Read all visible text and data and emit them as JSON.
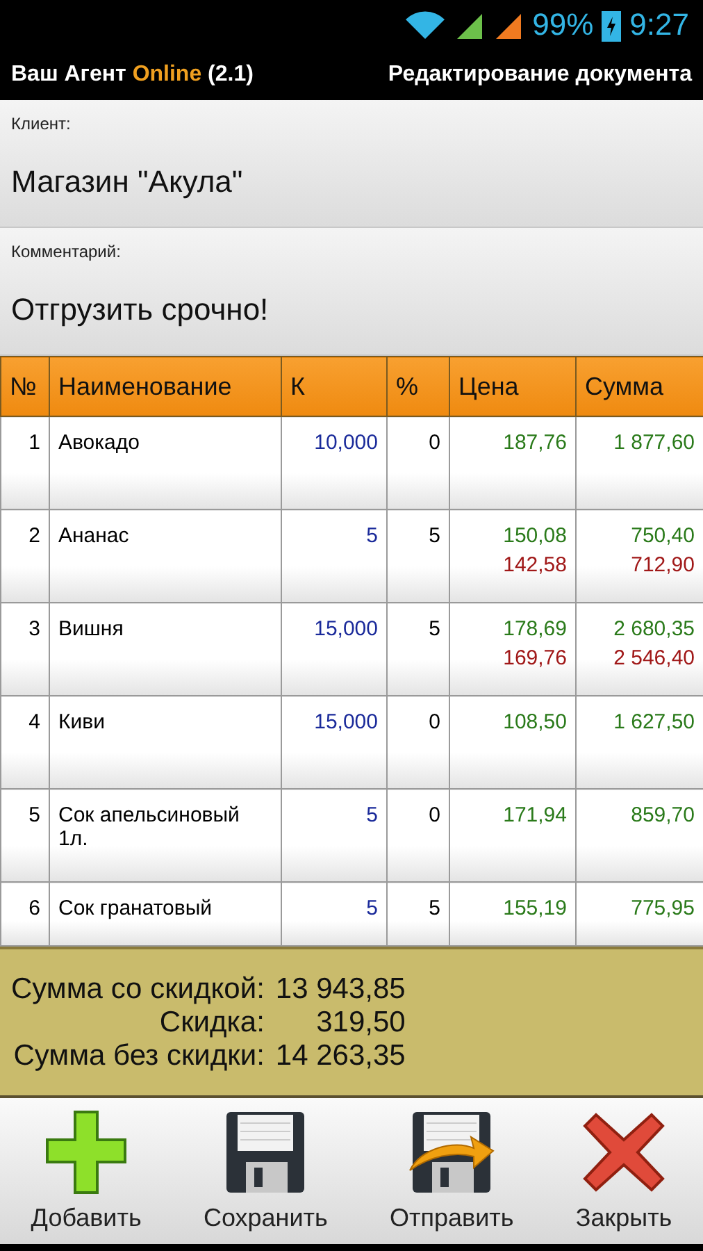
{
  "status_bar": {
    "battery": "99%",
    "time": "9:27"
  },
  "app_bar": {
    "title_prefix": "Ваш Агент",
    "title_accent": "Online",
    "version": "(2.1)",
    "screen_title": "Редактирование документа"
  },
  "fields": [
    {
      "label": "Клиент:",
      "value": "Магазин \"Акула\""
    },
    {
      "label": "Комментарий:",
      "value": "Отгрузить срочно!"
    }
  ],
  "table": {
    "columns": [
      "№",
      "Наименование",
      "К",
      "%",
      "Цена",
      "Сумма"
    ],
    "rows": [
      {
        "number": "1",
        "name": "Авокадо",
        "quantity": "10,000",
        "discount": "0",
        "price": "187,76",
        "sum": "1 877,60"
      },
      {
        "number": "2",
        "name": "Ананас",
        "quantity": "5",
        "discount": "5",
        "price": "150,08",
        "price_discounted": "142,58",
        "sum": "750,40",
        "sum_discounted": "712,90"
      },
      {
        "number": "3",
        "name": "Вишня",
        "quantity": "15,000",
        "discount": "5",
        "price": "178,69",
        "price_discounted": "169,76",
        "sum": "2 680,35",
        "sum_discounted": "2 546,40"
      },
      {
        "number": "4",
        "name": "Киви",
        "quantity": "15,000",
        "discount": "0",
        "price": "108,50",
        "sum": "1 627,50"
      },
      {
        "number": "5",
        "name": "Сок апельсиновый 1л.",
        "quantity": "5",
        "discount": "0",
        "price": "171,94",
        "sum": "859,70"
      },
      {
        "number": "6",
        "name": "Сок гранатовый",
        "quantity": "5",
        "discount": "5",
        "price": "155,19",
        "sum": "775,95"
      }
    ]
  },
  "totals": [
    {
      "label": "Сумма со скидкой:",
      "value": "13 943,85"
    },
    {
      "label": "Скидка:",
      "value": "319,50"
    },
    {
      "label": "Сумма без скидки:",
      "value": "14 263,35"
    }
  ],
  "toolbar": [
    {
      "kind": "add",
      "label": "Добавить"
    },
    {
      "kind": "save",
      "label": "Сохранить"
    },
    {
      "kind": "send",
      "label": "Отправить"
    },
    {
      "kind": "close",
      "label": "Закрыть"
    }
  ]
}
